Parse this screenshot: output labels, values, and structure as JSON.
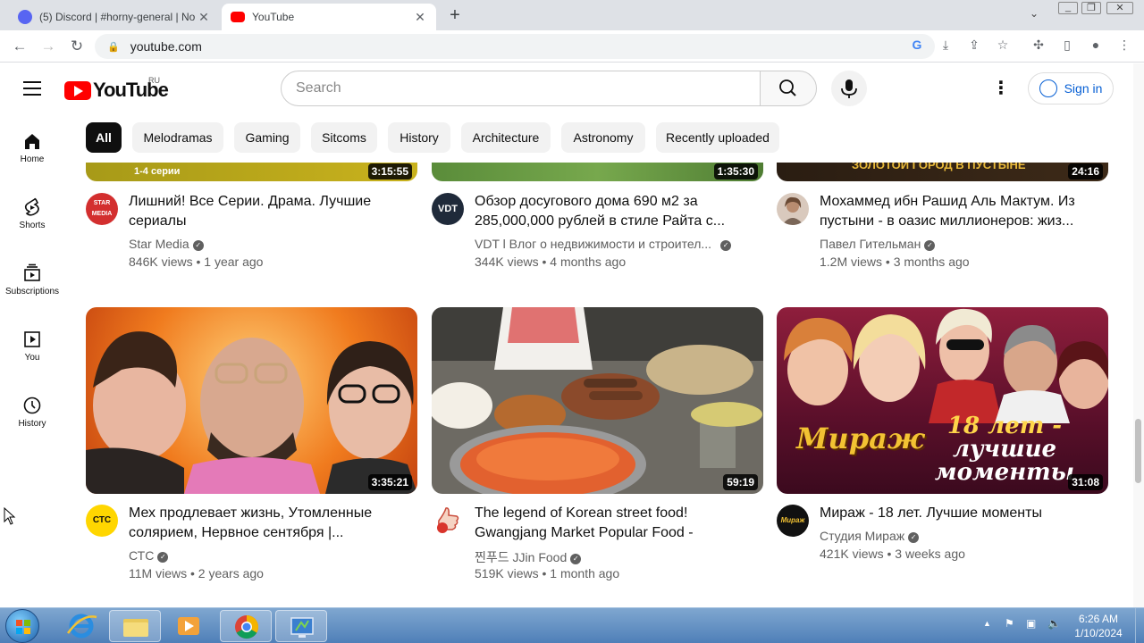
{
  "browser": {
    "tabs": [
      {
        "title": "(5) Discord | #horny-general | No",
        "active": false
      },
      {
        "title": "YouTube",
        "active": true
      }
    ],
    "url": "youtube.com"
  },
  "youtube": {
    "logo": "YouTube",
    "region": "RU",
    "search_placeholder": "Search",
    "sign_in": "Sign in",
    "sidebar": [
      {
        "label": "Home",
        "icon": "home-icon"
      },
      {
        "label": "Shorts",
        "icon": "shorts-icon"
      },
      {
        "label": "Subscriptions",
        "icon": "subscriptions-icon"
      },
      {
        "label": "You",
        "icon": "you-icon"
      },
      {
        "label": "History",
        "icon": "history-icon"
      }
    ],
    "chips": [
      "All",
      "Melodramas",
      "Gaming",
      "Sitcoms",
      "History",
      "Architecture",
      "Astronomy",
      "Recently uploaded"
    ],
    "videos": [
      {
        "title": "Лишний! Все Серии. Драма. Лучшие сериалы",
        "channel": "Star Media",
        "verified": true,
        "views": "846K views",
        "age": "1 year ago",
        "duration": "3:15:55",
        "thumb_caption": "1-4 серии",
        "avatar_text": "STAR MEDIA"
      },
      {
        "title": "Обзор досугового дома 690 м2 за 285,000,000 рублей в стиле Райта с...",
        "channel": "VDT l Влог о недвижимости и строител...",
        "verified": true,
        "views": "344K views",
        "age": "4 months ago",
        "duration": "1:35:30",
        "avatar_text": "VDT"
      },
      {
        "title": "Мохаммед ибн Рашид Аль Мактум. Из пустыни - в оазис миллионеров: жиз...",
        "channel": "Павел Гительман",
        "verified": true,
        "views": "1.2M views",
        "age": "3 months ago",
        "duration": "24:16",
        "thumb_caption": "ЗОЛОТОЙ ГОРОД В ПУСТЫНЕ"
      },
      {
        "title": "Мех продлевает жизнь, Утомленные солярием, Нервное сентября |...",
        "channel": "СТС",
        "verified": true,
        "views": "11M views",
        "age": "2 years ago",
        "duration": "3:35:21",
        "avatar_text": "СТС"
      },
      {
        "title": "The legend of Korean street food! Gwangjang Market Popular Food - BEST...",
        "channel": "찐푸드 JJin Food",
        "verified": true,
        "views": "519K views",
        "age": "1 month ago",
        "duration": "59:19"
      },
      {
        "title": "Мираж - 18 лет. Лучшие моменты",
        "channel": "Студия Мираж",
        "verified": true,
        "views": "421K views",
        "age": "3 weeks ago",
        "duration": "31:08",
        "thumb_caption_logo": "Мираж",
        "thumb_caption_1": "18 лет -",
        "thumb_caption_2": "лучшие",
        "thumb_caption_3": "моменты"
      }
    ]
  },
  "taskbar": {
    "time": "6:26 AM",
    "date": "1/10/2024"
  },
  "colors": {
    "yt_red": "#ff0000",
    "link_blue": "#065fd4",
    "chip_selected": "#0f0f0f",
    "taskbar": "#4f7fb8"
  }
}
